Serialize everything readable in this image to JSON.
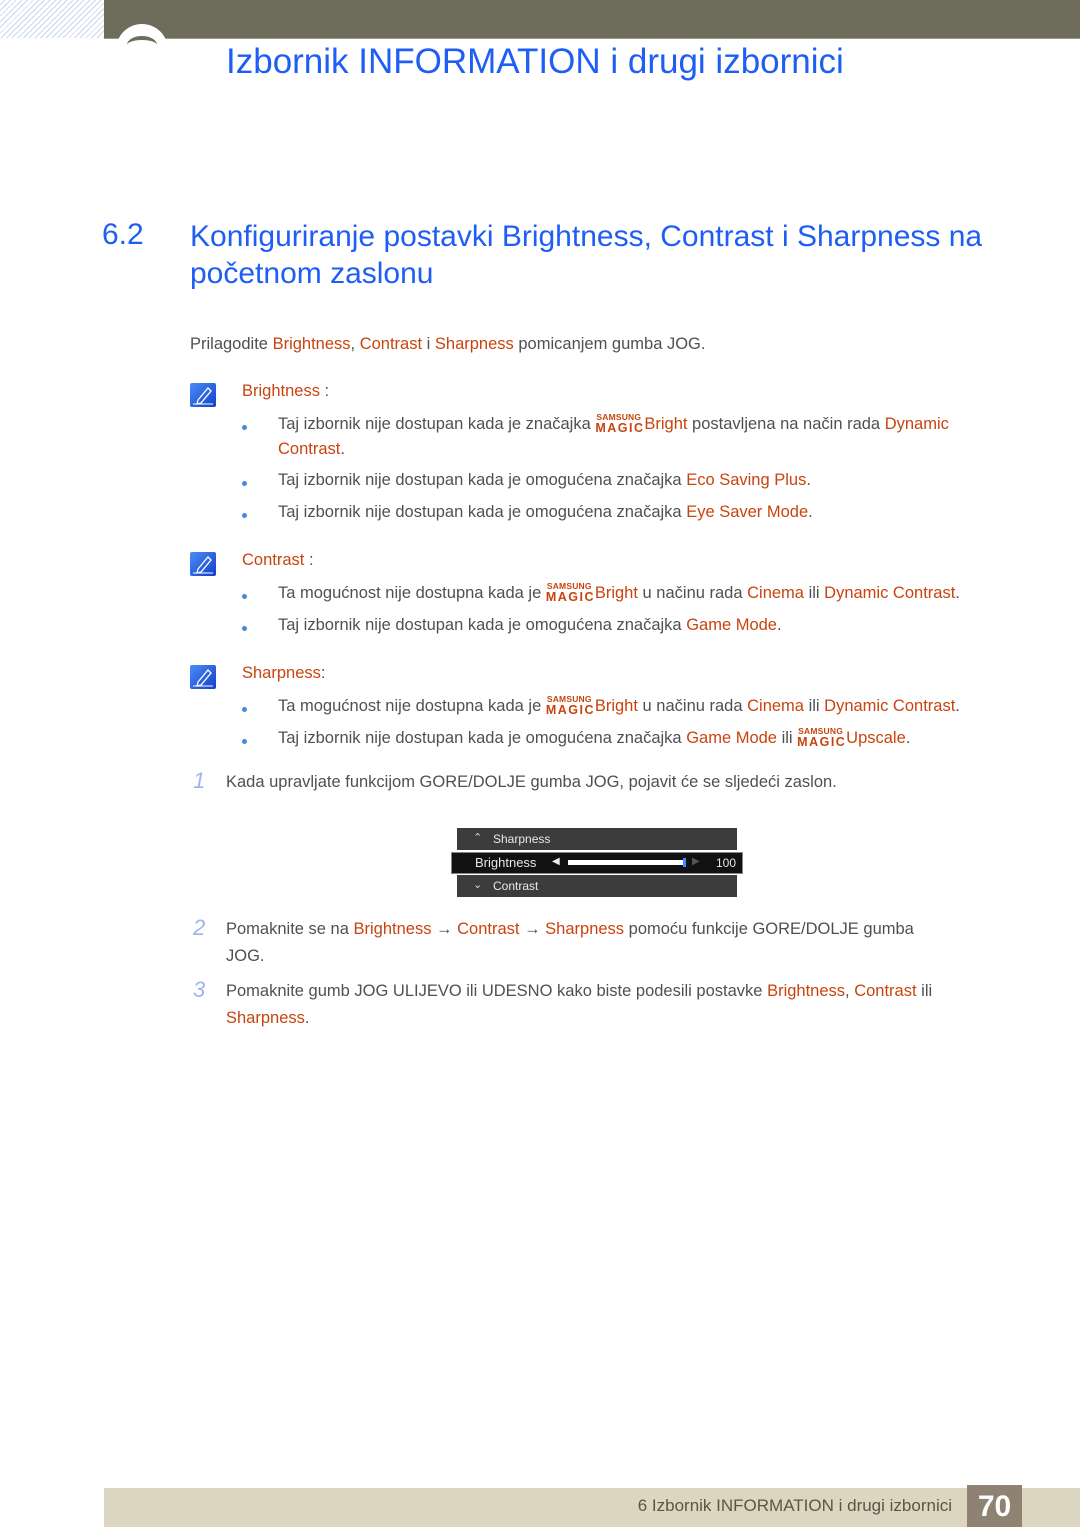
{
  "header": {
    "chapter_title": "Izbornik INFORMATION i drugi izbornici"
  },
  "section": {
    "number": "6.2",
    "title": "Konfiguriranje postavki Brightness, Contrast i Sharpness na početnom zaslonu"
  },
  "intro": {
    "t1": "Prilagodite ",
    "b1": "Brightness",
    "t2": ", ",
    "b2": "Contrast",
    "t3": " i ",
    "b3": "Sharpness",
    "t4": " pomicanjem gumba JOG."
  },
  "magic": {
    "top": "SAMSUNG",
    "bottom": "MAGIC"
  },
  "notes": {
    "brightness": {
      "label": "Brightness",
      "colon": " :",
      "b1": {
        "t1": "Taj izbornik nije dostupan kada je značajka ",
        "m": "Bright",
        "t2": " postavljena na način rada ",
        "h1": "Dynamic",
        "h2": "Contrast",
        "t3": "."
      },
      "b2": {
        "t1": "Taj izbornik nije dostupan kada je omogućena značajka ",
        "h1": "Eco Saving Plus",
        "t2": "."
      },
      "b3": {
        "t1": "Taj izbornik nije dostupan kada je omogućena značajka ",
        "h1": "Eye Saver Mode",
        "t2": "."
      }
    },
    "contrast": {
      "label": "Contrast",
      "colon": " :",
      "b1": {
        "t1": "Ta mogućnost nije dostupna kada je ",
        "m": "Bright",
        "t2": " u načinu rada ",
        "h1": "Cinema",
        "t3": " ili ",
        "h2": "Dynamic Contrast",
        "t4": "."
      },
      "b2": {
        "t1": "Taj izbornik nije dostupan kada je omogućena značajka ",
        "h1": "Game Mode",
        "t2": "."
      }
    },
    "sharpness": {
      "label": "Sharpness",
      "colon": ":",
      "b1": {
        "t1": "Ta mogućnost nije dostupna kada je ",
        "m": "Bright",
        "t2": " u načinu rada ",
        "h1": "Cinema",
        "t3": " ili ",
        "h2": "Dynamic Contrast",
        "t4": "."
      },
      "b2": {
        "t1": "Taj izbornik nije dostupan kada je omogućena značajka ",
        "h1": "Game Mode",
        "t2": " ili ",
        "m": "Upscale",
        "t3": "."
      }
    }
  },
  "steps": [
    {
      "num": "1",
      "text": "Kada upravljate funkcijom GORE/DOLJE gumba JOG, pojavit će se sljedeći zaslon."
    },
    {
      "num": "2",
      "t1": "Pomaknite se na ",
      "h1": "Brightness",
      "arrow": " → ",
      "h2": "Contrast",
      "h3": "Sharpness",
      "t2": " pomoću funkcije GORE/DOLJE gumba",
      "t3": "JOG."
    },
    {
      "num": "3",
      "t1": "Pomaknite gumb JOG ULIJEVO ili UDESNO kako biste podesili postavke ",
      "h1": "Brightness",
      "t2": ", ",
      "h2": "Contrast",
      "t3": " ili",
      "h3": "Sharpness",
      "t4": "."
    }
  ],
  "osd": {
    "up_item": "Sharpness",
    "selected_item": "Brightness",
    "down_item": "Contrast",
    "value": "100",
    "level_fraction": 1.0,
    "chevron_up": "^",
    "chevron_down": "v"
  },
  "footer": {
    "text": "6 Izbornik INFORMATION i drugi izbornici",
    "page": "70"
  }
}
